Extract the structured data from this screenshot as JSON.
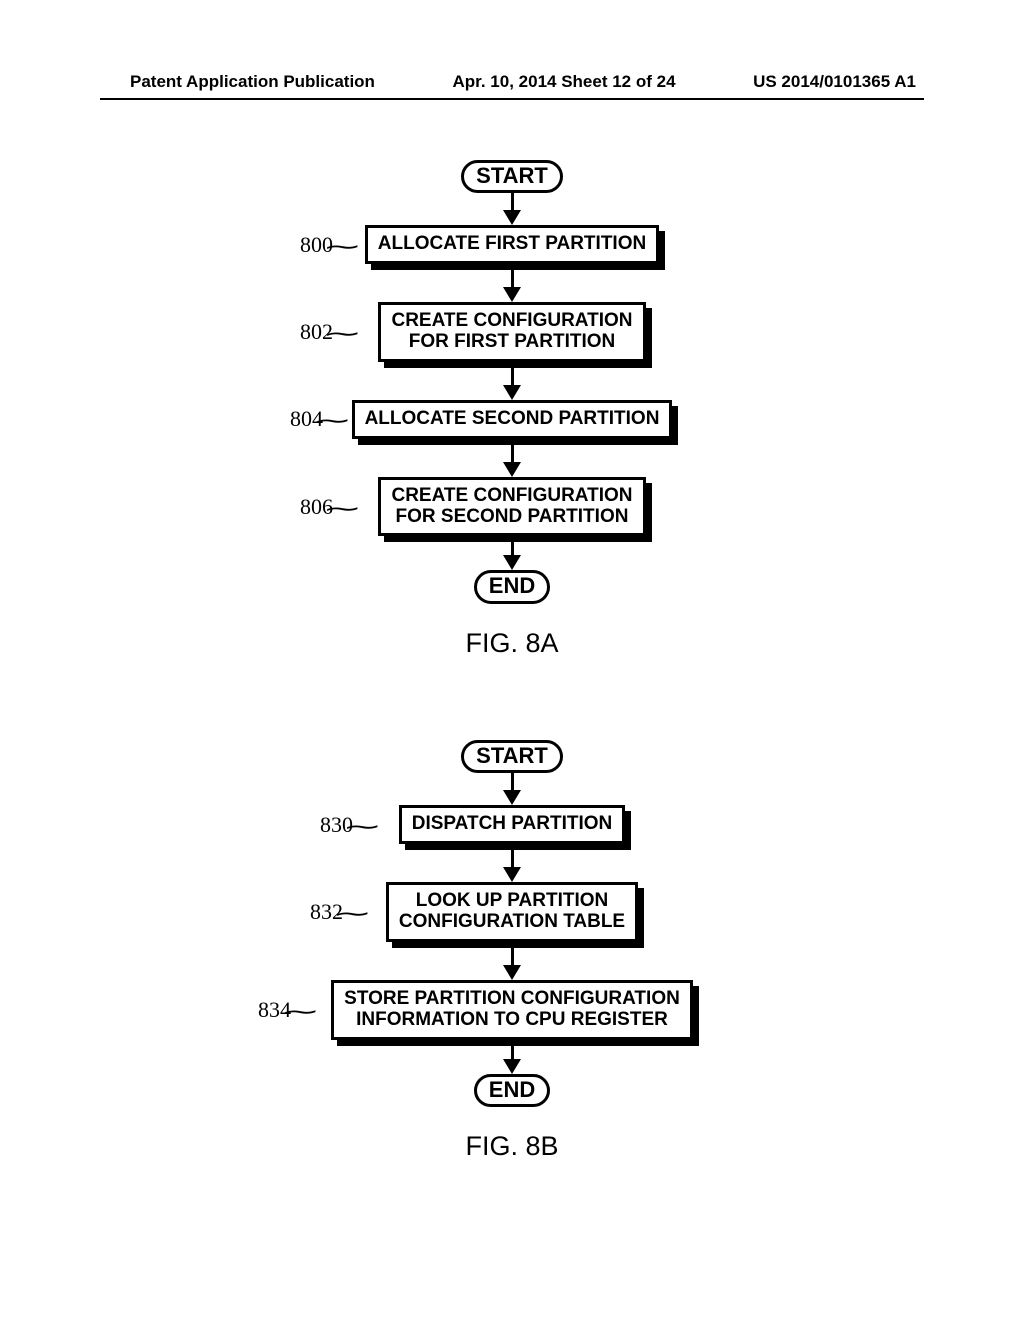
{
  "header": {
    "left": "Patent Application Publication",
    "middle": "Apr. 10, 2014  Sheet 12 of 24",
    "right": "US 2014/0101365 A1"
  },
  "figA": {
    "start": "START",
    "steps": [
      {
        "ref": "800",
        "text": "ALLOCATE FIRST PARTITION"
      },
      {
        "ref": "802",
        "text": "CREATE CONFIGURATION\nFOR FIRST PARTITION"
      },
      {
        "ref": "804",
        "text": "ALLOCATE SECOND PARTITION"
      },
      {
        "ref": "806",
        "text": "CREATE CONFIGURATION\nFOR SECOND PARTITION"
      }
    ],
    "end": "END",
    "caption": "FIG. 8A"
  },
  "figB": {
    "start": "START",
    "steps": [
      {
        "ref": "830",
        "text": "DISPATCH PARTITION"
      },
      {
        "ref": "832",
        "text": "LOOK UP PARTITION\nCONFIGURATION TABLE"
      },
      {
        "ref": "834",
        "text": "STORE PARTITION CONFIGURATION\nINFORMATION TO CPU REGISTER"
      }
    ],
    "end": "END",
    "caption": "FIG. 8B"
  }
}
